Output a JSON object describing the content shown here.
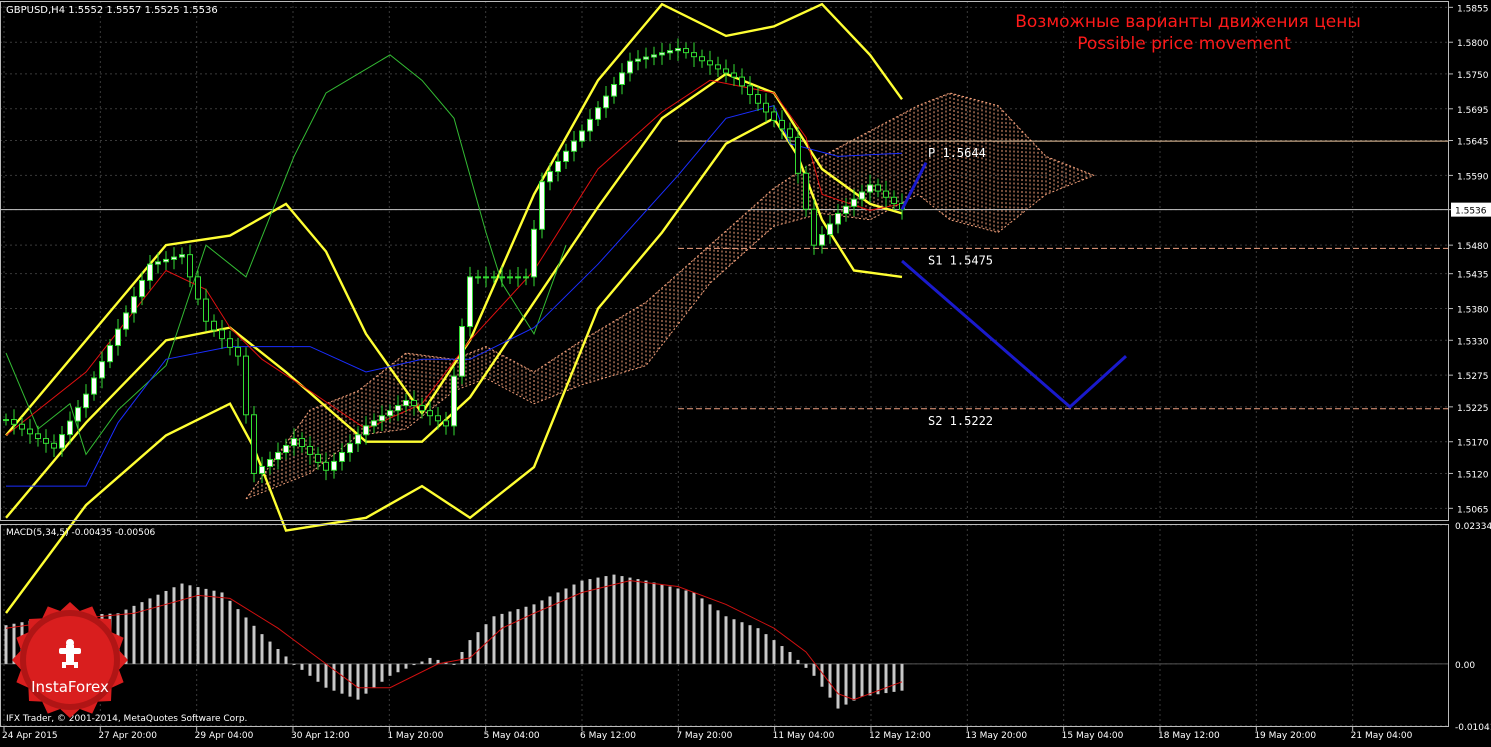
{
  "chart_data": {
    "type": "candlestick",
    "symbol_header": "GBPUSD,H4  1.5552 1.5557 1.5525 1.5536",
    "title": "Возможные варианты движения цены",
    "subtitle": "Possible price movement",
    "copyright": "IFX Trader, © 2001-2014, MetaQuotes Software Corp.",
    "logo_text": "InstaForex",
    "colors": {
      "background": "#000000",
      "grid": "#3a3a3a",
      "candle": "#33dd33",
      "candle_bull_fill": "#ffffff",
      "bollinger": "#ffff33",
      "tenkan": "#e01010",
      "kijun": "#1a2dff",
      "chikou": "#33bb33",
      "cloud": "#f2a07a",
      "macd_hist": "#c8c8c8",
      "macd_signal": "#d01010",
      "forecast": "#1a1acc",
      "title": "#ff1a1a",
      "logo": "#d91e1e"
    },
    "price_axis": {
      "ylim": [
        1.5045,
        1.5865
      ],
      "ticks": [
        "1.5855",
        "1.5800",
        "1.5750",
        "1.5695",
        "1.5645",
        "1.5590",
        "1.5536",
        "1.5480",
        "1.5435",
        "1.5380",
        "1.5330",
        "1.5275",
        "1.5225",
        "1.5170",
        "1.5120",
        "1.5065"
      ],
      "current_price_label": "1.5536"
    },
    "time_axis": {
      "ticks": [
        "24 Apr 2015",
        "27 Apr 20:00",
        "29 Apr 04:00",
        "30 Apr 12:00",
        "1 May 20:00",
        "5 May 04:00",
        "6 May 12:00",
        "7 May 20:00",
        "11 May 04:00",
        "12 May 12:00",
        "13 May 20:00",
        "15 May 04:00",
        "18 May 12:00",
        "19 May 20:00",
        "21 May 04:00"
      ]
    },
    "levels": [
      {
        "label": "P  1.5644",
        "value": 1.5644,
        "style": "solid",
        "color": "#f0c8a0"
      },
      {
        "label": "S1  1.5475",
        "value": 1.5475,
        "style": "dashed",
        "color": "#f0a080"
      },
      {
        "label": "S2  1.5222",
        "value": 1.5222,
        "style": "dashed",
        "color": "#f0a080"
      },
      {
        "label": "",
        "value": 1.5536,
        "style": "solid",
        "color": "#c8c8c8"
      }
    ],
    "forecast_paths": [
      {
        "name": "",
        "points": [
          [
            112,
            1.5536
          ],
          [
            115,
            1.561
          ]
        ]
      },
      {
        "name": "",
        "points": [
          [
            112,
            1.5455
          ],
          [
            133,
            1.5225
          ],
          [
            140,
            1.5305
          ]
        ]
      }
    ],
    "bars_count": 113,
    "candles": {
      "anchors": [
        [
          0,
          1.5205
        ],
        [
          6,
          1.516
        ],
        [
          10,
          1.5245
        ],
        [
          18,
          1.545
        ],
        [
          22,
          1.5465
        ],
        [
          25,
          1.536
        ],
        [
          29,
          1.5305
        ],
        [
          31,
          1.512
        ],
        [
          36,
          1.5175
        ],
        [
          40,
          1.5125
        ],
        [
          45,
          1.5195
        ],
        [
          50,
          1.5235
        ],
        [
          55,
          1.5195
        ],
        [
          58,
          1.543
        ],
        [
          65,
          1.543
        ],
        [
          67,
          1.558
        ],
        [
          72,
          1.566
        ],
        [
          78,
          1.577
        ],
        [
          84,
          1.579
        ],
        [
          91,
          1.5745
        ],
        [
          95,
          1.569
        ],
        [
          98,
          1.565
        ],
        [
          101,
          1.548
        ],
        [
          104,
          1.553
        ],
        [
          108,
          1.5575
        ],
        [
          112,
          1.5536
        ]
      ],
      "range": 0.0045
    },
    "bollinger": {
      "middle": [
        [
          0,
          1.505
        ],
        [
          10,
          1.52
        ],
        [
          20,
          1.533
        ],
        [
          28,
          1.535
        ],
        [
          35,
          1.528
        ],
        [
          45,
          1.517
        ],
        [
          52,
          1.517
        ],
        [
          58,
          1.524
        ],
        [
          66,
          1.539
        ],
        [
          74,
          1.554
        ],
        [
          82,
          1.568
        ],
        [
          90,
          1.575
        ],
        [
          96,
          1.572
        ],
        [
          102,
          1.56
        ],
        [
          108,
          1.5545
        ],
        [
          112,
          1.553
        ]
      ],
      "upper": [
        [
          0,
          1.518
        ],
        [
          10,
          1.533
        ],
        [
          20,
          1.548
        ],
        [
          28,
          1.5495
        ],
        [
          35,
          1.5545
        ],
        [
          40,
          1.547
        ],
        [
          45,
          1.534
        ],
        [
          52,
          1.5215
        ],
        [
          58,
          1.533
        ],
        [
          66,
          1.556
        ],
        [
          74,
          1.574
        ],
        [
          82,
          1.586
        ],
        [
          90,
          1.581
        ],
        [
          96,
          1.5825
        ],
        [
          102,
          1.586
        ],
        [
          108,
          1.578
        ],
        [
          112,
          1.571
        ]
      ],
      "lower": [
        [
          0,
          1.49
        ],
        [
          10,
          1.507
        ],
        [
          20,
          1.518
        ],
        [
          28,
          1.523
        ],
        [
          31,
          1.516
        ],
        [
          35,
          1.503
        ],
        [
          45,
          1.505
        ],
        [
          52,
          1.51
        ],
        [
          58,
          1.505
        ],
        [
          66,
          1.513
        ],
        [
          74,
          1.538
        ],
        [
          82,
          1.55
        ],
        [
          90,
          1.564
        ],
        [
          96,
          1.568
        ],
        [
          99,
          1.562
        ],
        [
          102,
          1.552
        ],
        [
          106,
          1.544
        ],
        [
          112,
          1.543
        ]
      ]
    },
    "tenkan": [
      [
        0,
        1.518
      ],
      [
        10,
        1.528
      ],
      [
        20,
        1.544
      ],
      [
        25,
        1.541
      ],
      [
        28,
        1.535
      ],
      [
        32,
        1.53
      ],
      [
        38,
        1.525
      ],
      [
        45,
        1.519
      ],
      [
        52,
        1.523
      ],
      [
        58,
        1.533
      ],
      [
        66,
        1.544
      ],
      [
        74,
        1.56
      ],
      [
        82,
        1.569
      ],
      [
        88,
        1.574
      ],
      [
        96,
        1.572
      ],
      [
        100,
        1.565
      ],
      [
        102,
        1.556
      ],
      [
        108,
        1.5535
      ],
      [
        112,
        1.5545
      ]
    ],
    "kijun": [
      [
        0,
        1.51
      ],
      [
        10,
        1.51
      ],
      [
        14,
        1.52
      ],
      [
        20,
        1.53
      ],
      [
        28,
        1.532
      ],
      [
        38,
        1.532
      ],
      [
        45,
        1.528
      ],
      [
        52,
        1.53
      ],
      [
        58,
        1.53
      ],
      [
        66,
        1.535
      ],
      [
        74,
        1.545
      ],
      [
        84,
        1.559
      ],
      [
        90,
        1.568
      ],
      [
        96,
        1.57
      ],
      [
        98,
        1.564
      ],
      [
        104,
        1.562
      ],
      [
        112,
        1.5625
      ]
    ],
    "chikou": [
      [
        0,
        1.531
      ],
      [
        4,
        1.519
      ],
      [
        8,
        1.523
      ],
      [
        10,
        1.515
      ],
      [
        14,
        1.522
      ],
      [
        20,
        1.529
      ],
      [
        25,
        1.548
      ],
      [
        30,
        1.543
      ],
      [
        36,
        1.562
      ],
      [
        40,
        1.572
      ],
      [
        44,
        1.575
      ],
      [
        48,
        1.578
      ],
      [
        52,
        1.574
      ],
      [
        56,
        1.568
      ],
      [
        60,
        1.55
      ],
      [
        62,
        1.542
      ],
      [
        66,
        1.534
      ],
      [
        70,
        1.548
      ]
    ],
    "cloud": {
      "span_a": [
        [
          30,
          1.508
        ],
        [
          38,
          1.522
        ],
        [
          44,
          1.525
        ],
        [
          50,
          1.531
        ],
        [
          56,
          1.53
        ],
        [
          60,
          1.532
        ],
        [
          66,
          1.528
        ],
        [
          72,
          1.533
        ],
        [
          80,
          1.539
        ],
        [
          88,
          1.548
        ],
        [
          96,
          1.557
        ],
        [
          102,
          1.562
        ],
        [
          108,
          1.566
        ],
        [
          114,
          1.57
        ],
        [
          118,
          1.572
        ],
        [
          124,
          1.57
        ],
        [
          130,
          1.562
        ],
        [
          136,
          1.559
        ]
      ],
      "span_b": [
        [
          30,
          1.508
        ],
        [
          38,
          1.512
        ],
        [
          44,
          1.518
        ],
        [
          50,
          1.519
        ],
        [
          56,
          1.525
        ],
        [
          60,
          1.527
        ],
        [
          66,
          1.523
        ],
        [
          72,
          1.526
        ],
        [
          80,
          1.529
        ],
        [
          88,
          1.542
        ],
        [
          96,
          1.551
        ],
        [
          102,
          1.553
        ],
        [
          108,
          1.552
        ],
        [
          114,
          1.556
        ],
        [
          118,
          1.552
        ],
        [
          124,
          1.55
        ],
        [
          130,
          1.556
        ],
        [
          136,
          1.559
        ]
      ]
    },
    "macd": {
      "label": "MACD(5,34,5) -0.00435 -0.00506",
      "ylim": [
        -0.0106,
        0.0235
      ],
      "ticks": [
        "0.02334",
        "0.00",
        "-0.01041"
      ],
      "hist": [
        [
          0,
          0.0065
        ],
        [
          6,
          0.008
        ],
        [
          14,
          0.0085
        ],
        [
          22,
          0.0135
        ],
        [
          27,
          0.012
        ],
        [
          32,
          0.005
        ],
        [
          36,
          0.0
        ],
        [
          40,
          -0.004
        ],
        [
          44,
          -0.006
        ],
        [
          48,
          -0.002
        ],
        [
          53,
          0.001
        ],
        [
          56,
          0.0
        ],
        [
          58,
          0.004
        ],
        [
          61,
          0.008
        ],
        [
          66,
          0.01
        ],
        [
          72,
          0.014
        ],
        [
          76,
          0.015
        ],
        [
          80,
          0.014
        ],
        [
          86,
          0.012
        ],
        [
          90,
          0.008
        ],
        [
          94,
          0.006
        ],
        [
          98,
          0.002
        ],
        [
          101,
          -0.002
        ],
        [
          104,
          -0.0075
        ],
        [
          107,
          -0.0055
        ],
        [
          112,
          -0.0045
        ]
      ],
      "signal": [
        [
          0,
          0.006
        ],
        [
          8,
          0.0075
        ],
        [
          16,
          0.0085
        ],
        [
          24,
          0.0115
        ],
        [
          28,
          0.011
        ],
        [
          34,
          0.006
        ],
        [
          40,
          0.0
        ],
        [
          44,
          -0.004
        ],
        [
          48,
          -0.004
        ],
        [
          54,
          0.0
        ],
        [
          58,
          0.001
        ],
        [
          62,
          0.006
        ],
        [
          66,
          0.0085
        ],
        [
          72,
          0.012
        ],
        [
          78,
          0.014
        ],
        [
          84,
          0.013
        ],
        [
          90,
          0.01
        ],
        [
          96,
          0.006
        ],
        [
          100,
          0.002
        ],
        [
          104,
          -0.005
        ],
        [
          106,
          -0.006
        ],
        [
          112,
          -0.003
        ]
      ]
    }
  }
}
